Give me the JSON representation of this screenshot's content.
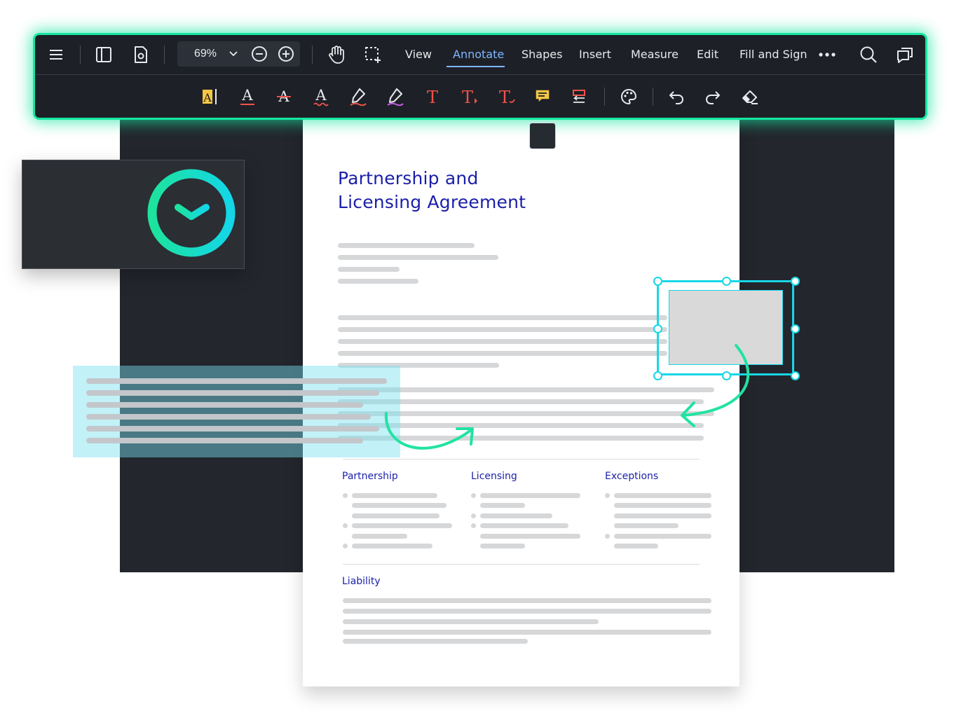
{
  "toolbar": {
    "zoom_value": "69%",
    "menu": [
      "View",
      "Annotate",
      "Shapes",
      "Insert",
      "Measure",
      "Edit",
      "Fill and Sign"
    ],
    "active_menu": "Annotate",
    "accent_color": "#15e6a0",
    "icons_row1": [
      "hamburger-menu-icon",
      "sidebar-panel-icon",
      "document-settings-icon",
      "chevron-down-icon",
      "zoom-out-icon",
      "zoom-in-icon",
      "pan-hand-icon",
      "area-select-icon",
      "more-icon",
      "search-icon",
      "comments-icon"
    ],
    "icons_row2": [
      "text-highlight-icon",
      "underline-icon",
      "strikeout-icon",
      "squiggly-icon",
      "free-highlight-icon",
      "free-hand-icon",
      "free-text-icon",
      "callout-text-icon",
      "text-insert-icon",
      "sticky-note-icon",
      "text-replace-icon",
      "color-palette-icon",
      "undo-icon",
      "redo-icon",
      "eraser-icon"
    ]
  },
  "document": {
    "title_line1": "Partnership and",
    "title_line2": "Licensing Agreement",
    "sections": {
      "partnership": "Partnership",
      "licensing": "Licensing",
      "exceptions": "Exceptions",
      "liability": "Liability"
    },
    "title_color": "#1a1fa8"
  },
  "colors": {
    "selection": "#18d7e6",
    "arrow": "#21e3a2",
    "highlight": "#78e1f0"
  }
}
